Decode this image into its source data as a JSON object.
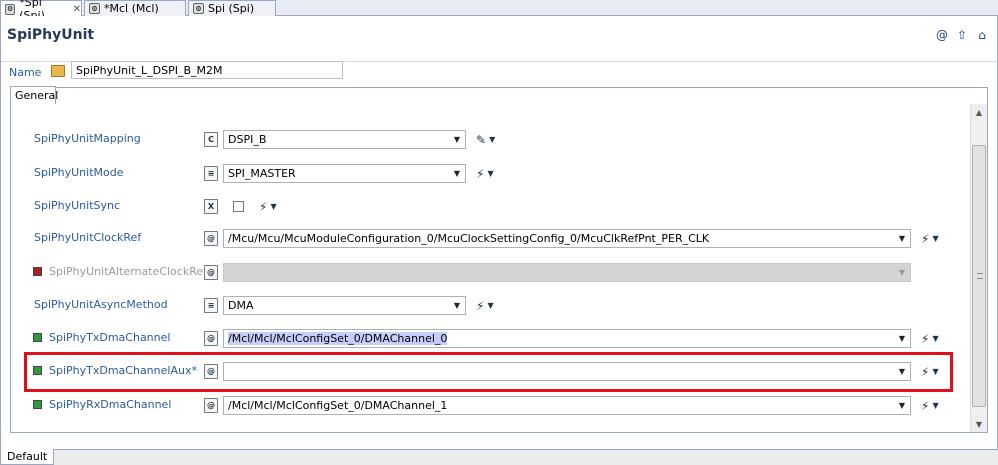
{
  "tabs": [
    {
      "label": "*Spi (Spi)",
      "close": "✕"
    },
    {
      "label": "*Mcl (Mcl)"
    },
    {
      "label": "Spi (Spi)"
    }
  ],
  "editor": {
    "title": "SpiPhyUnit",
    "name_label": "Name",
    "name_value": "SpiPhyUnit_L_DSPI_B_M2M",
    "general_tab": "General"
  },
  "rows": [
    {
      "label": "SpiPhyUnitMapping",
      "value": "DSPI_B"
    },
    {
      "label": "SpiPhyUnitMode",
      "value": "SPI_MASTER"
    },
    {
      "label": "SpiPhyUnitSync"
    },
    {
      "label": "SpiPhyUnitClockRef",
      "value": "/Mcu/Mcu/McuModuleConfiguration_0/McuClockSettingConfig_0/McuClkRefPnt_PER_CLK"
    },
    {
      "label": "SpiPhyUnitAlternateClockRef",
      "value": ""
    },
    {
      "label": "SpiPhyUnitAsyncMethod",
      "value": "DMA"
    },
    {
      "label": "SpiPhyTxDmaChannel",
      "value": "/Mcl/Mcl/MclConfigSet_0/DMAChannel_0"
    },
    {
      "label": "SpiPhyTxDmaChannelAux*",
      "value": ""
    },
    {
      "label": "SpiPhyRxDmaChannel",
      "value": "/Mcl/Mcl/MclConfigSet_0/DMAChannel_1"
    }
  ],
  "bottom_tab": "Default",
  "colors": {
    "highlight_border": "#e0101a",
    "label_blue": "#2b5a9c"
  }
}
